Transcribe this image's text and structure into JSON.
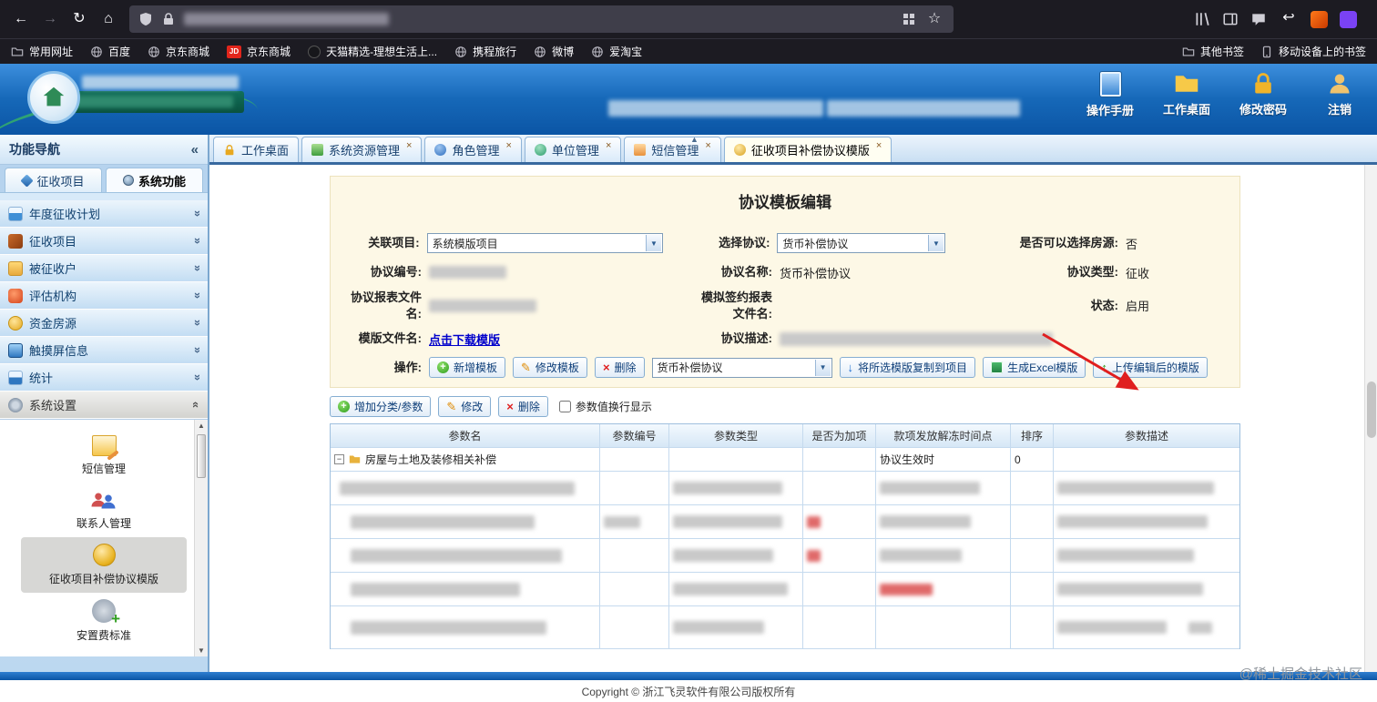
{
  "glyphs": {
    "back": "←",
    "forward": "→",
    "reload": "↻",
    "home": "⌂",
    "star": "☆",
    "undo": "↩",
    "collapse": "«",
    "chevron": "«",
    "triangle_up": "▲",
    "triangle_down": "▼",
    "close": "×",
    "select_arrow": "▼",
    "minus": "−",
    "plus": "+",
    "pencil": "✎",
    "cross": "×",
    "arrow_up": "↑",
    "arrow_down": "↓",
    "jd": "JD"
  },
  "browser": {
    "bookmarks": [
      {
        "label": "常用网址"
      },
      {
        "label": "百度"
      },
      {
        "label": "京东商城"
      },
      {
        "label": "京东商城"
      },
      {
        "label": "天猫精选-理想生活上..."
      },
      {
        "label": "携程旅行"
      },
      {
        "label": "微博"
      },
      {
        "label": "爱淘宝"
      }
    ],
    "other_bookmarks": "其他书签",
    "mobile_bookmarks": "移动设备上的书签"
  },
  "header": {
    "actions": [
      {
        "label": "操作手册"
      },
      {
        "label": "工作桌面"
      },
      {
        "label": "修改密码"
      },
      {
        "label": "注销"
      }
    ]
  },
  "sidebar": {
    "title": "功能导航",
    "tabs": [
      {
        "label": "征收项目"
      },
      {
        "label": "系统功能"
      }
    ],
    "menu": [
      {
        "label": "年度征收计划"
      },
      {
        "label": "征收项目"
      },
      {
        "label": "被征收户"
      },
      {
        "label": "评估机构"
      },
      {
        "label": "资金房源"
      },
      {
        "label": "触摸屏信息"
      },
      {
        "label": "统计"
      },
      {
        "label": "系统设置"
      }
    ],
    "submenu": [
      {
        "label": "短信管理"
      },
      {
        "label": "联系人管理"
      },
      {
        "label": "征收项目补偿协议模版"
      },
      {
        "label": "安置费标准"
      }
    ]
  },
  "tabbar": [
    {
      "label": "工作桌面"
    },
    {
      "label": "系统资源管理"
    },
    {
      "label": "角色管理"
    },
    {
      "label": "单位管理"
    },
    {
      "label": "短信管理"
    },
    {
      "label": "征收项目补偿协议模版"
    }
  ],
  "form": {
    "title": "协议模板编辑",
    "f1_label": "关联项目:",
    "f1_value": "系统模版项目",
    "f2_label": "选择协议:",
    "f2_value": "货币补偿协议",
    "f3_label": "是否可以选择房源:",
    "f3_value": "否",
    "f4_label": "协议编号:",
    "f5_label": "协议名称:",
    "f5_value": "货币补偿协议",
    "f6_label": "协议类型:",
    "f6_value": "征收",
    "f7_label": "协议报表文件名:",
    "f8_label": "模拟签约报表文件名:",
    "f9_label": "状态:",
    "f9_value": "启用",
    "f10_label": "模版文件名:",
    "f10_link": "点击下载模版",
    "f11_label": "协议描述:",
    "op_label": "操作:",
    "op_buttons": [
      {
        "label": "新增模板"
      },
      {
        "label": "修改模板"
      },
      {
        "label": "删除"
      }
    ],
    "op_select": "货币补偿协议",
    "op_buttons2": [
      {
        "label": "将所选模版复制到项目"
      },
      {
        "label": "生成Excel模版"
      },
      {
        "label": "上传编辑后的模版"
      }
    ]
  },
  "params": {
    "buttons": [
      {
        "label": "增加分类/参数"
      },
      {
        "label": "修改"
      },
      {
        "label": "删除"
      }
    ],
    "wrap_label": "参数值换行显示",
    "headers": [
      "参数名",
      "参数编号",
      "参数类型",
      "是否为加项",
      "款项发放解冻时间点",
      "排序",
      "参数描述"
    ],
    "row1": {
      "name": "房屋与土地及装修相关补偿",
      "unfreeze": "协议生效时",
      "sort": "0"
    }
  },
  "footer": {
    "copyright": "Copyright © 浙江飞灵软件有限公司版权所有"
  },
  "watermark": "@稀土掘金技术社区"
}
